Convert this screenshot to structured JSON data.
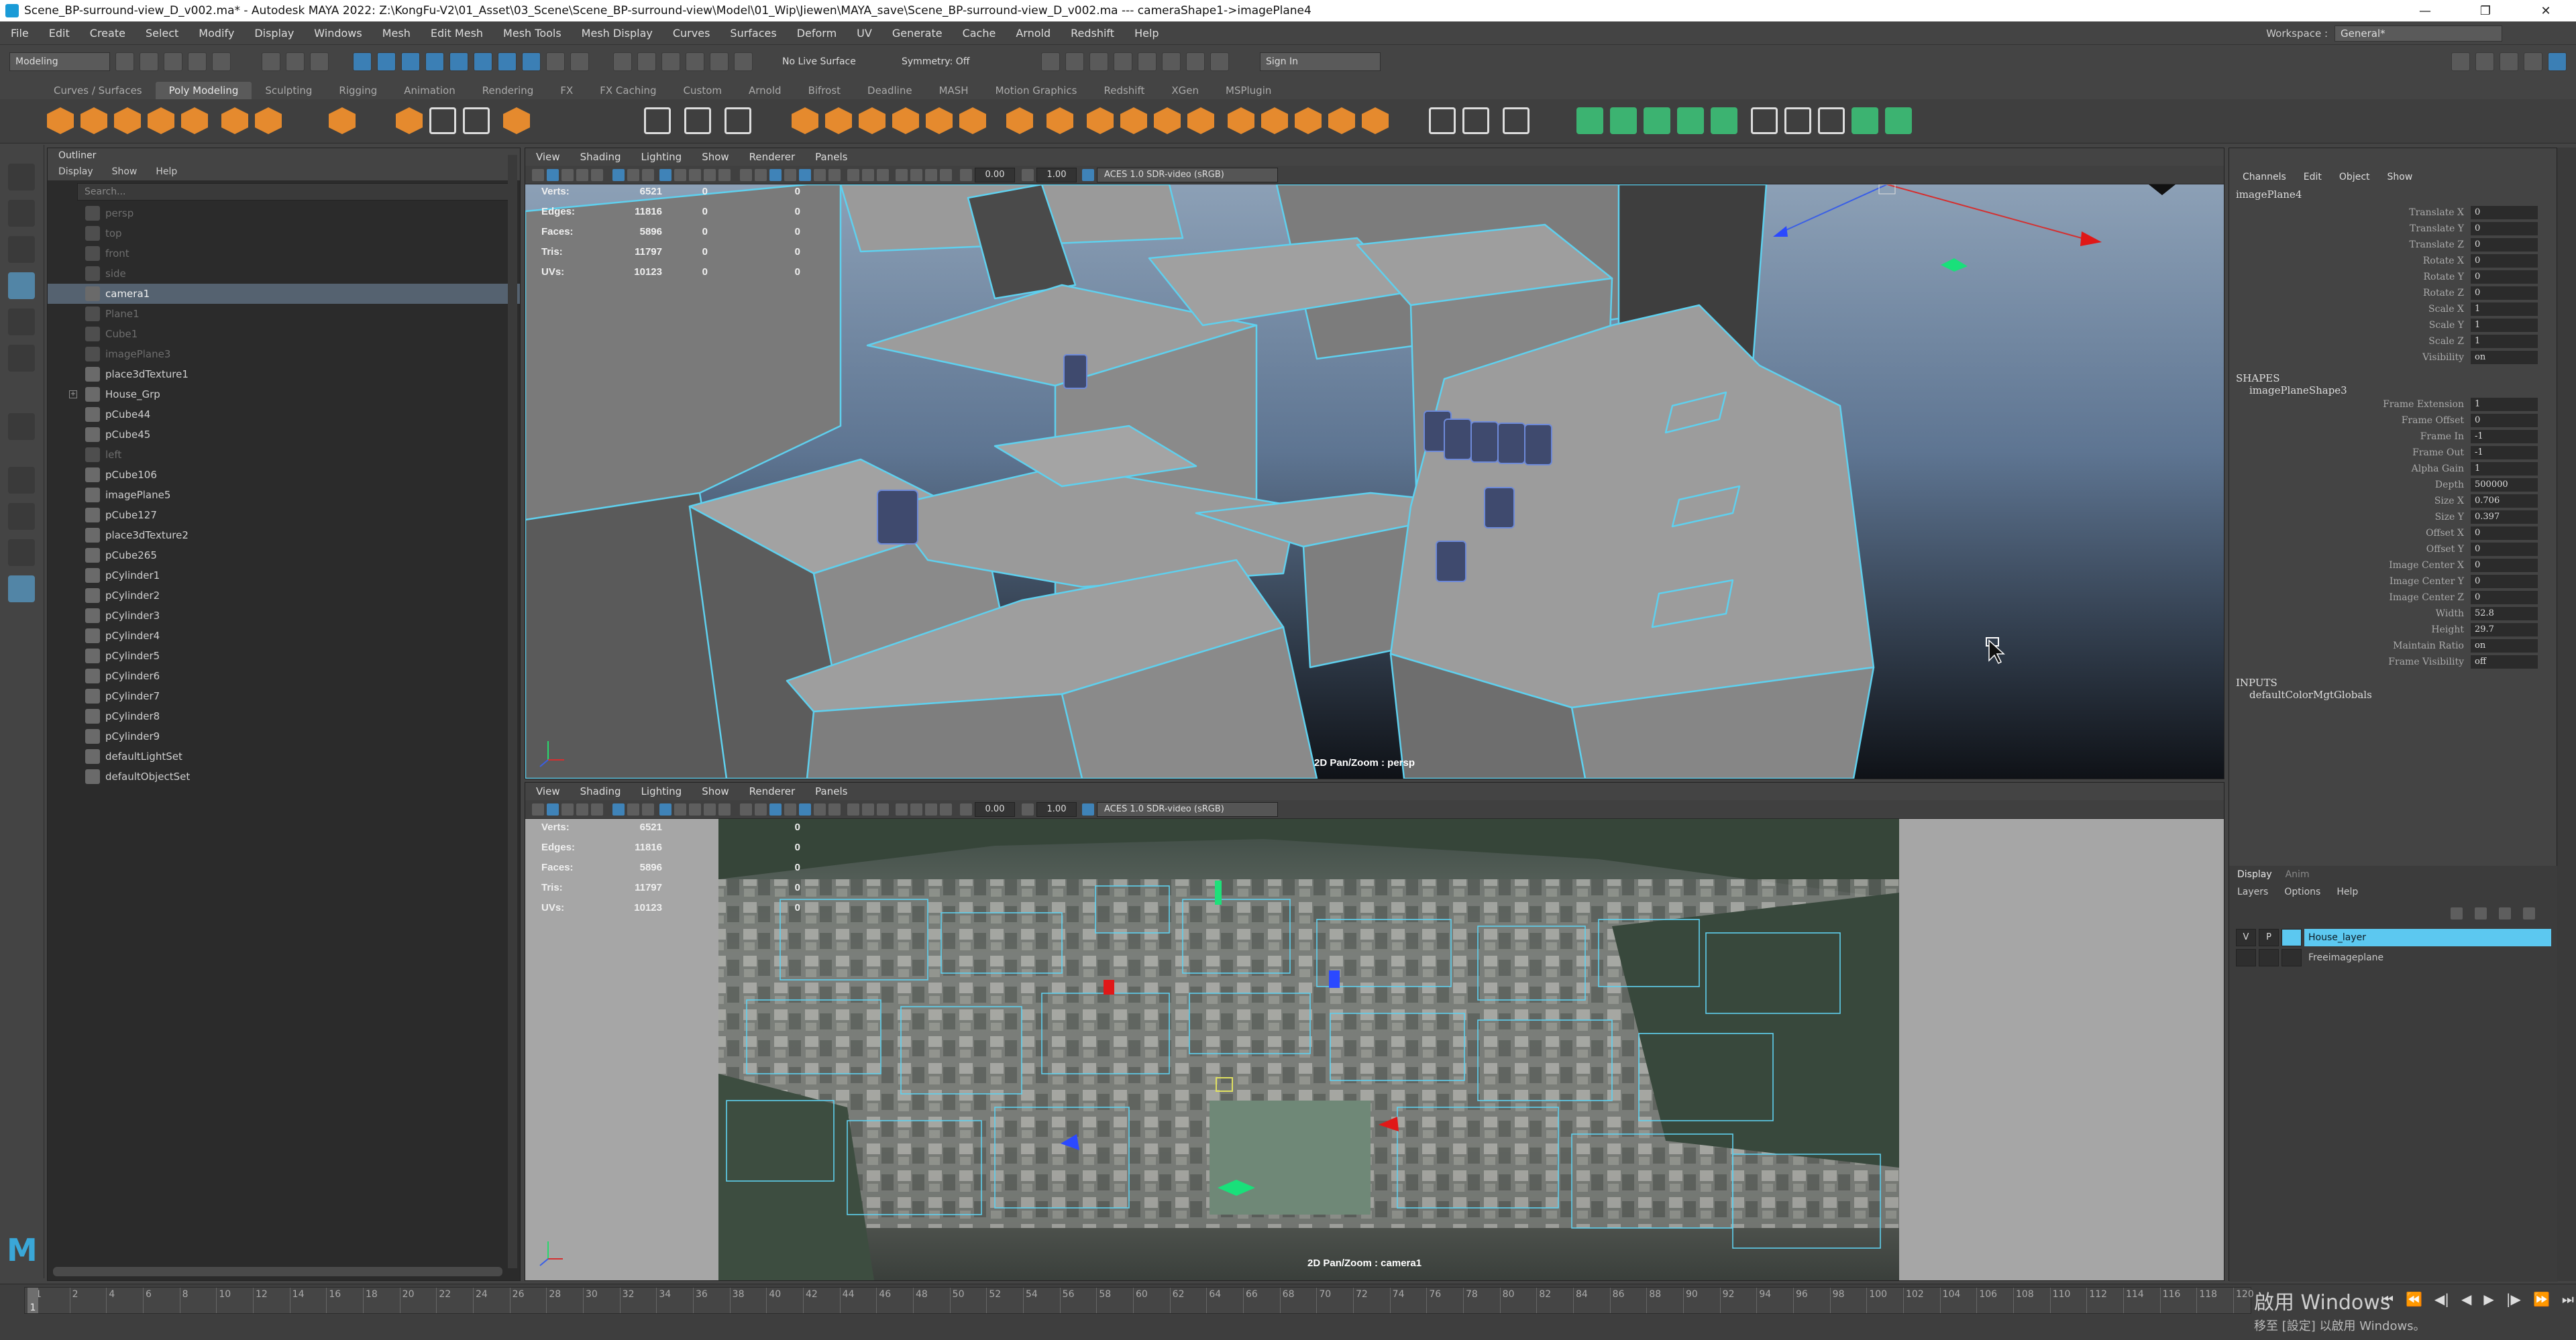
{
  "titlebar": {
    "title": "Scene_BP-surround-view_D_v002.ma* - Autodesk MAYA 2022: Z:\\KongFu-V2\\01_Asset\\03_Scene\\Scene_BP-surround-view\\Model\\01_Wip\\Jiewen\\MAYA_save\\Scene_BP-surround-view_D_v002.ma  ---  cameraShape1->imagePlane4",
    "minimize": "—",
    "restore": "❐",
    "close": "✕"
  },
  "menubar": {
    "items": [
      "File",
      "Edit",
      "Create",
      "Select",
      "Modify",
      "Display",
      "Windows",
      "Mesh",
      "Edit Mesh",
      "Mesh Tools",
      "Mesh Display",
      "Curves",
      "Surfaces",
      "Deform",
      "UV",
      "Generate",
      "Cache",
      "Arnold",
      "Redshift",
      "Help"
    ],
    "workspace_label": "Workspace :",
    "workspace_value": "General*"
  },
  "statusline": {
    "mode": "Modeling",
    "live_surface": "No Live Surface",
    "symmetry": "Symmetry: Off",
    "signin": "Sign In"
  },
  "shelf": {
    "tabs": [
      "Curves / Surfaces",
      "Poly Modeling",
      "Sculpting",
      "Rigging",
      "Animation",
      "Rendering",
      "FX",
      "FX Caching",
      "Custom",
      "Arnold",
      "Bifrost",
      "Deadline",
      "MASH",
      "Motion Graphics",
      "Redshift",
      "XGen",
      "MSPlugin"
    ],
    "active_tab": 1
  },
  "outliner": {
    "header": "Outliner",
    "menu": [
      "Display",
      "Show",
      "Help"
    ],
    "search_placeholder": "Search...",
    "items": [
      {
        "label": "persp",
        "dim": true
      },
      {
        "label": "top",
        "dim": true
      },
      {
        "label": "front",
        "dim": true
      },
      {
        "label": "side",
        "dim": true
      },
      {
        "label": "camera1",
        "dim": false,
        "selected": true
      },
      {
        "label": "Plane1",
        "dim": true
      },
      {
        "label": "Cube1",
        "dim": true
      },
      {
        "label": "imagePlane3",
        "dim": true
      },
      {
        "label": "place3dTexture1",
        "dim": false
      },
      {
        "label": "House_Grp",
        "dim": false,
        "expander": true
      },
      {
        "label": "pCube44",
        "dim": false
      },
      {
        "label": "pCube45",
        "dim": false
      },
      {
        "label": "left",
        "dim": true
      },
      {
        "label": "pCube106",
        "dim": false
      },
      {
        "label": "imagePlane5",
        "dim": false
      },
      {
        "label": "pCube127",
        "dim": false
      },
      {
        "label": "place3dTexture2",
        "dim": false
      },
      {
        "label": "pCube265",
        "dim": false
      },
      {
        "label": "pCylinder1",
        "dim": false
      },
      {
        "label": "pCylinder2",
        "dim": false
      },
      {
        "label": "pCylinder3",
        "dim": false
      },
      {
        "label": "pCylinder4",
        "dim": false
      },
      {
        "label": "pCylinder5",
        "dim": false
      },
      {
        "label": "pCylinder6",
        "dim": false
      },
      {
        "label": "pCylinder7",
        "dim": false
      },
      {
        "label": "pCylinder8",
        "dim": false
      },
      {
        "label": "pCylinder9",
        "dim": false
      },
      {
        "label": "defaultLightSet",
        "dim": false
      },
      {
        "label": "defaultObjectSet",
        "dim": false
      }
    ]
  },
  "viewport_top": {
    "menu": [
      "View",
      "Shading",
      "Lighting",
      "Show",
      "Renderer",
      "Panels"
    ],
    "num1": "0.00",
    "num2": "1.00",
    "aces": "ACES 1.0 SDR-video (sRGB)",
    "hud": {
      "verts": {
        "label": "Verts:",
        "a": "6521",
        "b": "0",
        "c": "0"
      },
      "edges": {
        "label": "Edges:",
        "a": "11816",
        "b": "0",
        "c": "0"
      },
      "faces": {
        "label": "Faces:",
        "a": "5896",
        "b": "0",
        "c": "0"
      },
      "tris": {
        "label": "Tris:",
        "a": "11797",
        "b": "0",
        "c": "0"
      },
      "uvs": {
        "label": "UVs:",
        "a": "10123",
        "b": "0",
        "c": "0"
      }
    },
    "camera_label": "2D Pan/Zoom : persp"
  },
  "viewport_bottom": {
    "menu": [
      "View",
      "Shading",
      "Lighting",
      "Show",
      "Renderer",
      "Panels"
    ],
    "num1": "0.00",
    "num2": "1.00",
    "aces": "ACES 1.0 SDR-video (sRGB)",
    "hud": {
      "verts": {
        "label": "Verts:",
        "a": "6521",
        "b": "0"
      },
      "edges": {
        "label": "Edges:",
        "a": "11816",
        "b": "0"
      },
      "faces": {
        "label": "Faces:",
        "a": "5896",
        "b": "0"
      },
      "tris": {
        "label": "Tris:",
        "a": "11797",
        "b": "0"
      },
      "uvs": {
        "label": "UVs:",
        "a": "10123",
        "b": "0"
      }
    },
    "camera_label": "2D Pan/Zoom : camera1"
  },
  "channelbox": {
    "menu": [
      "Channels",
      "Edit",
      "Object",
      "Show"
    ],
    "node": "imagePlane4",
    "transform": [
      {
        "k": "Translate X",
        "v": "0"
      },
      {
        "k": "Translate Y",
        "v": "0"
      },
      {
        "k": "Translate Z",
        "v": "0"
      },
      {
        "k": "Rotate X",
        "v": "0"
      },
      {
        "k": "Rotate Y",
        "v": "0"
      },
      {
        "k": "Rotate Z",
        "v": "0"
      },
      {
        "k": "Scale X",
        "v": "1"
      },
      {
        "k": "Scale Y",
        "v": "1"
      },
      {
        "k": "Scale Z",
        "v": "1"
      },
      {
        "k": "Visibility",
        "v": "on"
      }
    ],
    "shapes_label": "SHAPES",
    "shape_node": "imagePlaneShape3",
    "shape_attrs": [
      {
        "k": "Frame Extension",
        "v": "1"
      },
      {
        "k": "Frame Offset",
        "v": "0"
      },
      {
        "k": "Frame In",
        "v": "-1"
      },
      {
        "k": "Frame Out",
        "v": "-1"
      },
      {
        "k": "Alpha Gain",
        "v": "1"
      },
      {
        "k": "Depth",
        "v": "500000"
      },
      {
        "k": "Size X",
        "v": "0.706"
      },
      {
        "k": "Size Y",
        "v": "0.397"
      },
      {
        "k": "Offset X",
        "v": "0"
      },
      {
        "k": "Offset Y",
        "v": "0"
      },
      {
        "k": "Image Center X",
        "v": "0"
      },
      {
        "k": "Image Center Y",
        "v": "0"
      },
      {
        "k": "Image Center Z",
        "v": "0"
      },
      {
        "k": "Width",
        "v": "52.8"
      },
      {
        "k": "Height",
        "v": "29.7"
      },
      {
        "k": "Maintain Ratio",
        "v": "on"
      },
      {
        "k": "Frame Visibility",
        "v": "off"
      }
    ],
    "inputs_label": "INPUTS",
    "input_node": "defaultColorMgtGlobals",
    "layers": {
      "tabs": [
        "Display",
        "Anim"
      ],
      "menu": [
        "Layers",
        "Options",
        "Help"
      ],
      "rows": [
        {
          "v": "V",
          "p": "P",
          "name": "House_layer",
          "active": true
        },
        {
          "v": "",
          "p": "",
          "name": "Freeimageplane",
          "active": false
        }
      ]
    }
  },
  "timeslider": {
    "ticks": [
      "1",
      "2",
      "4",
      "6",
      "8",
      "10",
      "12",
      "14",
      "16",
      "18",
      "20",
      "22",
      "24",
      "26",
      "28",
      "30",
      "32",
      "34",
      "36",
      "38",
      "40",
      "42",
      "44",
      "46",
      "48",
      "50",
      "52",
      "54",
      "56",
      "58",
      "60",
      "62",
      "64",
      "66",
      "68",
      "70",
      "72",
      "74",
      "76",
      "78",
      "80",
      "82",
      "84",
      "86",
      "88",
      "90",
      "92",
      "94",
      "96",
      "98",
      "100",
      "102",
      "104",
      "106",
      "108",
      "110",
      "112",
      "114",
      "116",
      "118",
      "120"
    ],
    "current_frame": "1",
    "watermark_line1": "啟用 Windows",
    "watermark_line2": "移至 [設定] 以啟用 Windows。"
  },
  "colors": {
    "wire": "#5fd0ee",
    "accent_blue": "#5285a6",
    "layer_highlight": "#5cc8f0"
  }
}
